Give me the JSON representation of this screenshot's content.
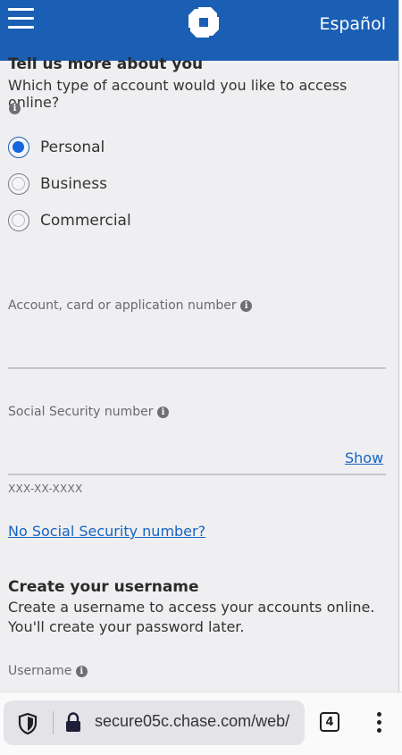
{
  "header": {
    "language_link": "Español",
    "logo_icon": "chase-octagon-logo-icon",
    "menu_icon": "hamburger-menu-icon"
  },
  "about_you": {
    "title": "Tell us more about you",
    "question": "Which type of account would you like to access online?",
    "options": [
      "Personal",
      "Business",
      "Commercial"
    ],
    "selected": "Personal"
  },
  "account_field": {
    "label": "Account, card or application number",
    "value": ""
  },
  "ssn_field": {
    "label": "Social Security number",
    "show_label": "Show",
    "format_hint": "XXX-XX-XXXX",
    "no_ssn_link": "No Social Security number?"
  },
  "username_section": {
    "title": "Create your username",
    "description_line1": "Create a username to access your accounts online.",
    "description_line2": "You'll create your password later.",
    "field_label": "Username"
  },
  "browser": {
    "url": "secure05c.chase.com/web/",
    "tab_count": "4",
    "accent_color": "#1a5fb4"
  }
}
